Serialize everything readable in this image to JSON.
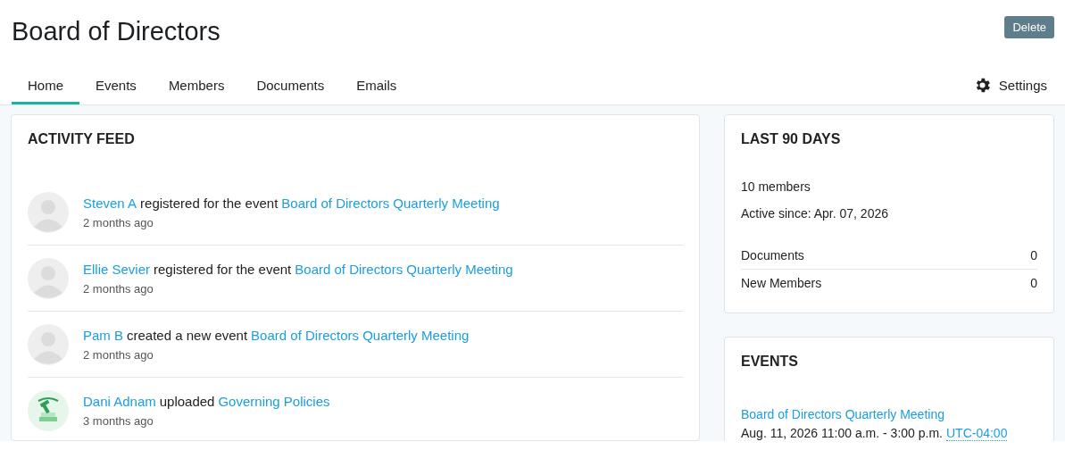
{
  "page": {
    "title": "Board of Directors",
    "delete_button": "Delete"
  },
  "tabs": [
    {
      "label": "Home",
      "selected": true
    },
    {
      "label": "Events",
      "selected": false
    },
    {
      "label": "Members",
      "selected": false
    },
    {
      "label": "Documents",
      "selected": false
    },
    {
      "label": "Emails",
      "selected": false
    }
  ],
  "settings": {
    "label": "Settings"
  },
  "activity_feed": {
    "title": "ACTIVITY FEED",
    "items": [
      {
        "actor": "Steven A",
        "action": "registered for the event",
        "target": "Board of Directors Quarterly Meeting",
        "time": "2 months ago",
        "avatar": {
          "kind": "placeholder"
        }
      },
      {
        "actor": "Ellie Sevier",
        "action": "registered for the event",
        "target": "Board of Directors Quarterly Meeting",
        "time": "2 months ago",
        "avatar": {
          "kind": "placeholder"
        }
      },
      {
        "actor": "Pam B",
        "action": "created a new event",
        "target": "Board of Directors Quarterly Meeting",
        "time": "2 months ago",
        "avatar": {
          "kind": "placeholder"
        }
      },
      {
        "actor": "Dani Adnam",
        "action": "uploaded",
        "target": "Governing Policies",
        "time": "3 months ago"
      }
    ]
  },
  "last_90_days": {
    "title": "LAST 90 DAYS",
    "members": "10 members",
    "active_since": "Active since: Apr. 07, 2026",
    "stats": [
      {
        "label": "Documents",
        "value": "0"
      },
      {
        "label": "New Members",
        "value": "0"
      }
    ]
  },
  "events": {
    "title": "EVENTS",
    "items": [
      {
        "title": "Board of Directors Quarterly Meeting",
        "when": "Aug. 11, 2026 11:00 a.m. - 3:00 p.m.",
        "timezone": "UTC-04:00"
      }
    ]
  }
}
